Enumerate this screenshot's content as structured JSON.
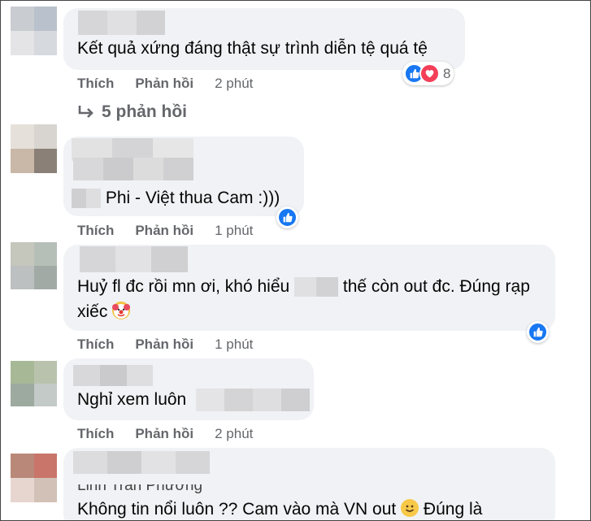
{
  "comments": [
    {
      "text": "Kết quả xứng đáng thật sự trình diễn tệ quá tệ",
      "like": "Thích",
      "reply": "Phản hồi",
      "time": "2 phút",
      "reaction_count": "8"
    },
    {
      "text": "Phi - Việt thua Cam :)))",
      "like": "Thích",
      "reply": "Phản hồi",
      "time": "1 phút"
    },
    {
      "line1_a": "Huỷ fl đc rồi mn ơi, khó hiểu",
      "line1_b": "thế còn out đc. Đúng rạp",
      "line2": "xiếc",
      "like": "Thích",
      "reply": "Phản hồi",
      "time": "1 phút"
    },
    {
      "text": "Nghỉ xem luôn",
      "like": "Thích",
      "reply": "Phản hồi",
      "time": "2 phút"
    },
    {
      "name_partial": "Linh Trần Phương",
      "text_a": "Không tin nổi luôn ?? Cam vào mà VN out",
      "text_b": "Đúng là"
    }
  ],
  "replies_link": "5 phản hồi",
  "icons": {
    "reply_arrow": "reply-arrow-icon",
    "like": "like-icon",
    "love": "love-icon",
    "clown": "clown-emoji",
    "smile": "smile-emoji"
  },
  "colors": {
    "like_blue": "#1877f2",
    "love_red": "#f33e58",
    "bubble": "#f0f2f5",
    "meta_gray": "#65676b"
  }
}
